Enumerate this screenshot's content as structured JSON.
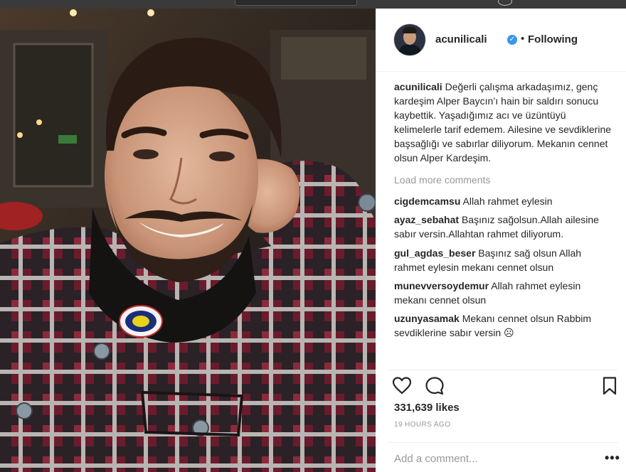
{
  "post": {
    "username": "acunilicali",
    "verified_glyph": "✓",
    "dot": "•",
    "follow_state": "Following",
    "caption_user": "acunilicali",
    "caption": "Değerli çalışma arkadaşımız, genç kardeşim Alper Baycın’ı hain bir saldırı sonucu kaybettik. Yaşadığımız acı ve üzüntüyü kelimelerle tarif edemem. Ailesine ve sevdiklerine başsağlığı ve sabırlar diliyorum. Mekanın cennet olsun Alper Kardeşim.",
    "load_more": "Load more comments",
    "comments": [
      {
        "user": "cigdemcamsu",
        "text": "Allah rahmet eylesin"
      },
      {
        "user": "ayaz_sebahat",
        "text": "Başınız sağolsun.Allah ailesine sabır versin.Allahtan rahmet diliyorum."
      },
      {
        "user": "gul_agdas_beser",
        "text": "Başınız sağ olsun Allah rahmet eylesin mekanı cennet olsun"
      },
      {
        "user": "munevversoydemur",
        "text": "Allah rahmet eylesin mekanı cennet olsun"
      },
      {
        "user": "uzunyasamak",
        "text": "Mekanı cennet olsun Rabbim sevdiklerine sabır versin ☹"
      }
    ],
    "likes": "331,639 likes",
    "time": "19 HOURS AGO",
    "add_comment_placeholder": "Add a comment...",
    "more_glyph": "•••"
  },
  "icons": {
    "like": "heart-icon",
    "comment": "comment-bubble-icon",
    "save": "bookmark-icon",
    "verified": "verified-badge-icon",
    "more": "more-options-icon"
  },
  "colors": {
    "verified": "#3897f0",
    "muted_text": "#999999",
    "text": "#262626",
    "divider": "#efefef"
  }
}
